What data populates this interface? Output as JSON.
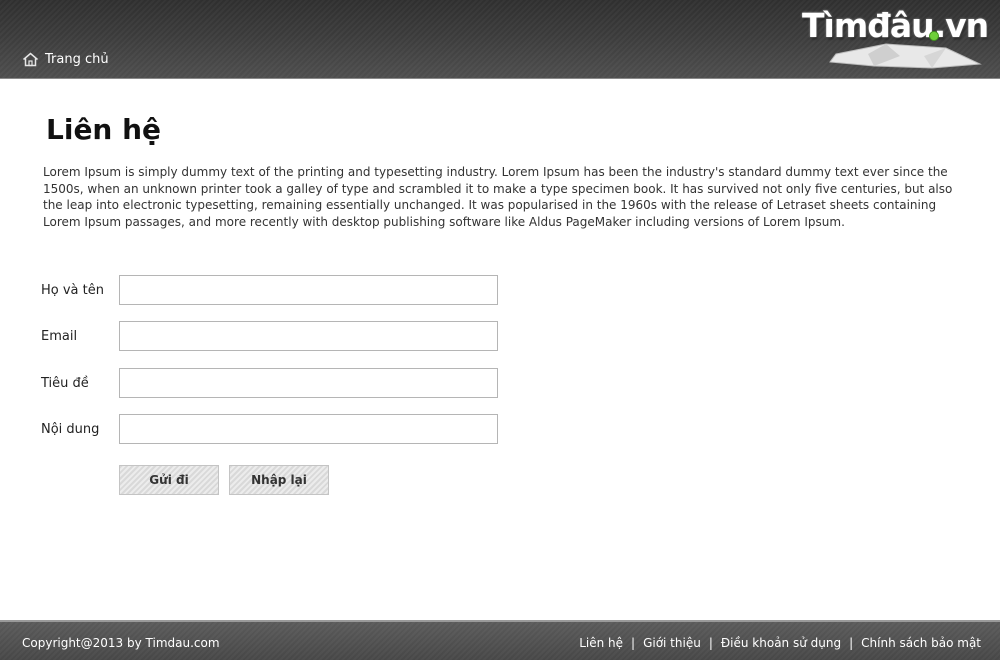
{
  "header": {
    "home_label": "Trang chủ",
    "logo_text": "Tìmđâu.vn"
  },
  "main": {
    "title": "Liên hệ",
    "intro": "Lorem Ipsum is simply dummy text of the printing and typesetting industry. Lorem Ipsum has been the industry's standard dummy text ever since the 1500s, when an unknown printer took a galley of type and scrambled it to make a type specimen book. It has survived not only five centuries, but also the leap into electronic typesetting, remaining essentially unchanged. It was popularised in the 1960s with the release of Letraset sheets containing Lorem Ipsum passages, and more recently with desktop publishing software like Aldus PageMaker including versions of Lorem Ipsum."
  },
  "form": {
    "name_label": "Họ và tên",
    "email_label": "Email",
    "subject_label": "Tiêu đề",
    "content_label": "Nội dung",
    "name_value": "",
    "email_value": "",
    "subject_value": "",
    "content_value": "",
    "submit_label": "Gửi đi",
    "reset_label": "Nhập lại"
  },
  "footer": {
    "copyright": "Copyright@2013 by Timdau.com",
    "links": [
      "Liên hệ",
      "Giới thiệu",
      "Điều khoản sử dụng",
      "Chính sách bảo mật"
    ],
    "separator": "|"
  },
  "colors": {
    "header_bg": "#3b3b3b",
    "footer_bg": "#4e4e4e",
    "logo_pin": "#6fcf3a"
  },
  "icons": {
    "home": "home-icon",
    "logo_map": "map-pin-icon"
  }
}
